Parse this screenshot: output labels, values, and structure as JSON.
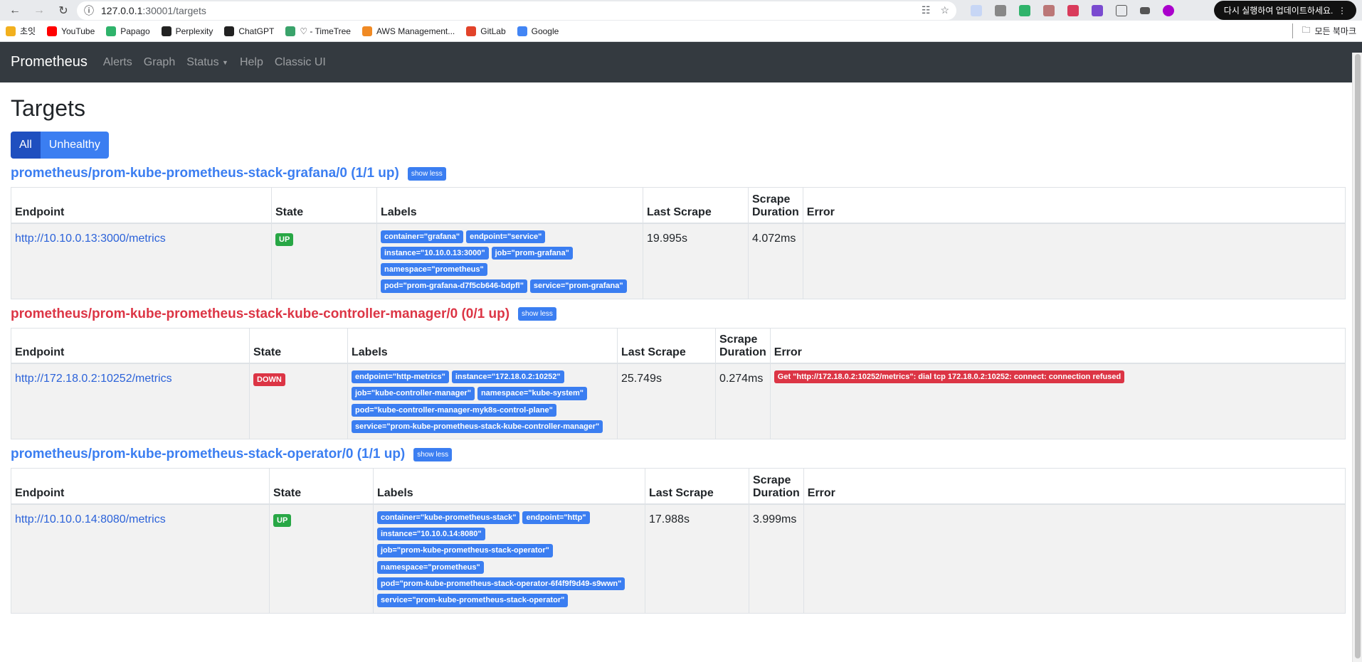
{
  "browser": {
    "url_host": "127.0.0.1",
    "url_path": ":30001/targets",
    "update_button": "다시 실행하여 업데이트하세요.",
    "bookmarks": [
      {
        "label": "초잇",
        "color": "#f2b01e"
      },
      {
        "label": "YouTube",
        "color": "#ff0000"
      },
      {
        "label": "Papago",
        "color": "#2fb36b"
      },
      {
        "label": "Perplexity",
        "color": "#222222"
      },
      {
        "label": "ChatGPT",
        "color": "#222222"
      },
      {
        "label": "♡ - TimeTree",
        "color": "#3aa36b"
      },
      {
        "label": "AWS Management...",
        "color": "#f08a24"
      },
      {
        "label": "GitLab",
        "color": "#e2432a"
      },
      {
        "label": "Google",
        "color": "#4285f4"
      }
    ],
    "all_bookmarks": "모든 북마크"
  },
  "navbar": {
    "brand": "Prometheus",
    "links": [
      "Alerts",
      "Graph",
      "Status",
      "Help",
      "Classic UI"
    ]
  },
  "page": {
    "title": "Targets",
    "filter_all": "All",
    "filter_unhealthy": "Unhealthy"
  },
  "columns": {
    "endpoint": "Endpoint",
    "state": "State",
    "labels": "Labels",
    "last_scrape": "Last Scrape",
    "scrape_duration_1": "Scrape",
    "scrape_duration_2": "Duration",
    "error": "Error"
  },
  "show_less": "show less",
  "groups": [
    {
      "title": "prometheus/prom-kube-prometheus-stack-grafana/0 (1/1 up)",
      "healthy": true,
      "endpoint": "http://10.10.0.13:3000/metrics",
      "state": "UP",
      "labels": [
        "container=\"grafana\"",
        "endpoint=\"service\"",
        "instance=\"10.10.0.13:3000\"",
        "job=\"prom-grafana\"",
        "namespace=\"prometheus\"",
        "pod=\"prom-grafana-d7f5cb646-bdpfl\"",
        "service=\"prom-grafana\""
      ],
      "last_scrape": "19.995s",
      "duration": "4.072ms",
      "error": ""
    },
    {
      "title": "prometheus/prom-kube-prometheus-stack-kube-controller-manager/0 (0/1 up)",
      "healthy": false,
      "endpoint": "http://172.18.0.2:10252/metrics",
      "state": "DOWN",
      "labels": [
        "endpoint=\"http-metrics\"",
        "instance=\"172.18.0.2:10252\"",
        "job=\"kube-controller-manager\"",
        "namespace=\"kube-system\"",
        "pod=\"kube-controller-manager-myk8s-control-plane\"",
        "service=\"prom-kube-prometheus-stack-kube-controller-manager\""
      ],
      "last_scrape": "25.749s",
      "duration": "0.274ms",
      "error": "Get \"http://172.18.0.2:10252/metrics\": dial tcp 172.18.0.2:10252: connect: connection refused"
    },
    {
      "title": "prometheus/prom-kube-prometheus-stack-operator/0 (1/1 up)",
      "healthy": true,
      "endpoint": "http://10.10.0.14:8080/metrics",
      "state": "UP",
      "labels": [
        "container=\"kube-prometheus-stack\"",
        "endpoint=\"http\"",
        "instance=\"10.10.0.14:8080\"",
        "job=\"prom-kube-prometheus-stack-operator\"",
        "namespace=\"prometheus\"",
        "pod=\"prom-kube-prometheus-stack-operator-6f4f9f9d49-s9wwn\"",
        "service=\"prom-kube-prometheus-stack-operator\""
      ],
      "last_scrape": "17.988s",
      "duration": "3.999ms",
      "error": ""
    }
  ]
}
